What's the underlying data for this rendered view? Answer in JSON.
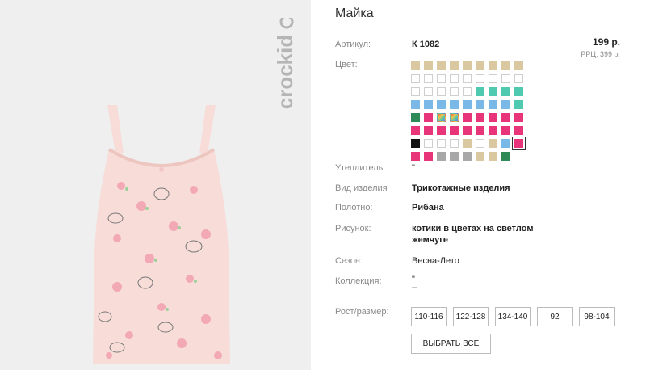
{
  "product": {
    "title": "Майка",
    "article_label": "Артикул:",
    "article_value": "К 1082",
    "price": "199 р.",
    "rrc": "РРЦ: 399 р.",
    "color_label": "Цвет:",
    "insulation_label": "Утеплитель:",
    "insulation_value": "\"",
    "type_label": "Вид изделия",
    "type_value": "Трикотажные изделия",
    "fabric_label": "Полотно:",
    "fabric_value": "Рибана",
    "pattern_label": "Рисунок:",
    "pattern_line1": "котики в цветах на светлом",
    "pattern_line2": "жемчуге",
    "season_label": "Сезон:",
    "season_value": "Весна-Лето",
    "collection_label": "Коллекция:",
    "collection_line1": "\"",
    "collection_line2": "–",
    "size_label": "Рост/размер:",
    "sizes": [
      "110-116",
      "122-128",
      "134-140",
      "92",
      "98-104"
    ],
    "select_all": "ВЫБРАТЬ ВСЕ"
  },
  "brand_logo_text": "crockid",
  "swatches": [
    "#d9c8a0",
    "#d9c8a0",
    "#d9c8a0",
    "#d9c8a0",
    "#d9c8a0",
    "#d9c8a0",
    "#d9c8a0",
    "#d9c8a0",
    "#d9c8a0",
    "#ffffff",
    "#ffffff",
    "#ffffff",
    "#ffffff",
    "#ffffff",
    "#ffffff",
    "#ffffff",
    "#ffffff",
    "#ffffff",
    "#ffffff",
    "#ffffff",
    "#ffffff",
    "#ffffff",
    "#ffffff",
    "#4fc9b0",
    "#4fc9b0",
    "#4fc9b0",
    "#4fc9b0",
    "#7ab8e8",
    "#7ab8e8",
    "#7ab8e8",
    "#7ab8e8",
    "#7ab8e8",
    "#7ab8e8",
    "#7ab8e8",
    "#7ab8e8",
    "#4fc9b0",
    "#2e8b57",
    "#e8357a",
    "rainbow",
    "rainbow",
    "#e8357a",
    "#e8357a",
    "#e8357a",
    "#e8357a",
    "#e8357a",
    "#e8357a",
    "#e8357a",
    "#e8357a",
    "#e8357a",
    "#e8357a",
    "#e8357a",
    "#e8357a",
    "#e8357a",
    "#e8357a",
    "#111111",
    "#ffffff",
    "#ffffff",
    "#ffffff",
    "#d9c8a0",
    "#ffffff",
    "#d9c8a0",
    "#7ab8e8",
    "#e8357a",
    "#e8357a",
    "#e8357a",
    "#a8a8a8",
    "#a8a8a8",
    "#a8a8a8",
    "#d9c8a0",
    "#d9c8a0",
    "#2e8b57"
  ],
  "selected_swatch_index": 62
}
